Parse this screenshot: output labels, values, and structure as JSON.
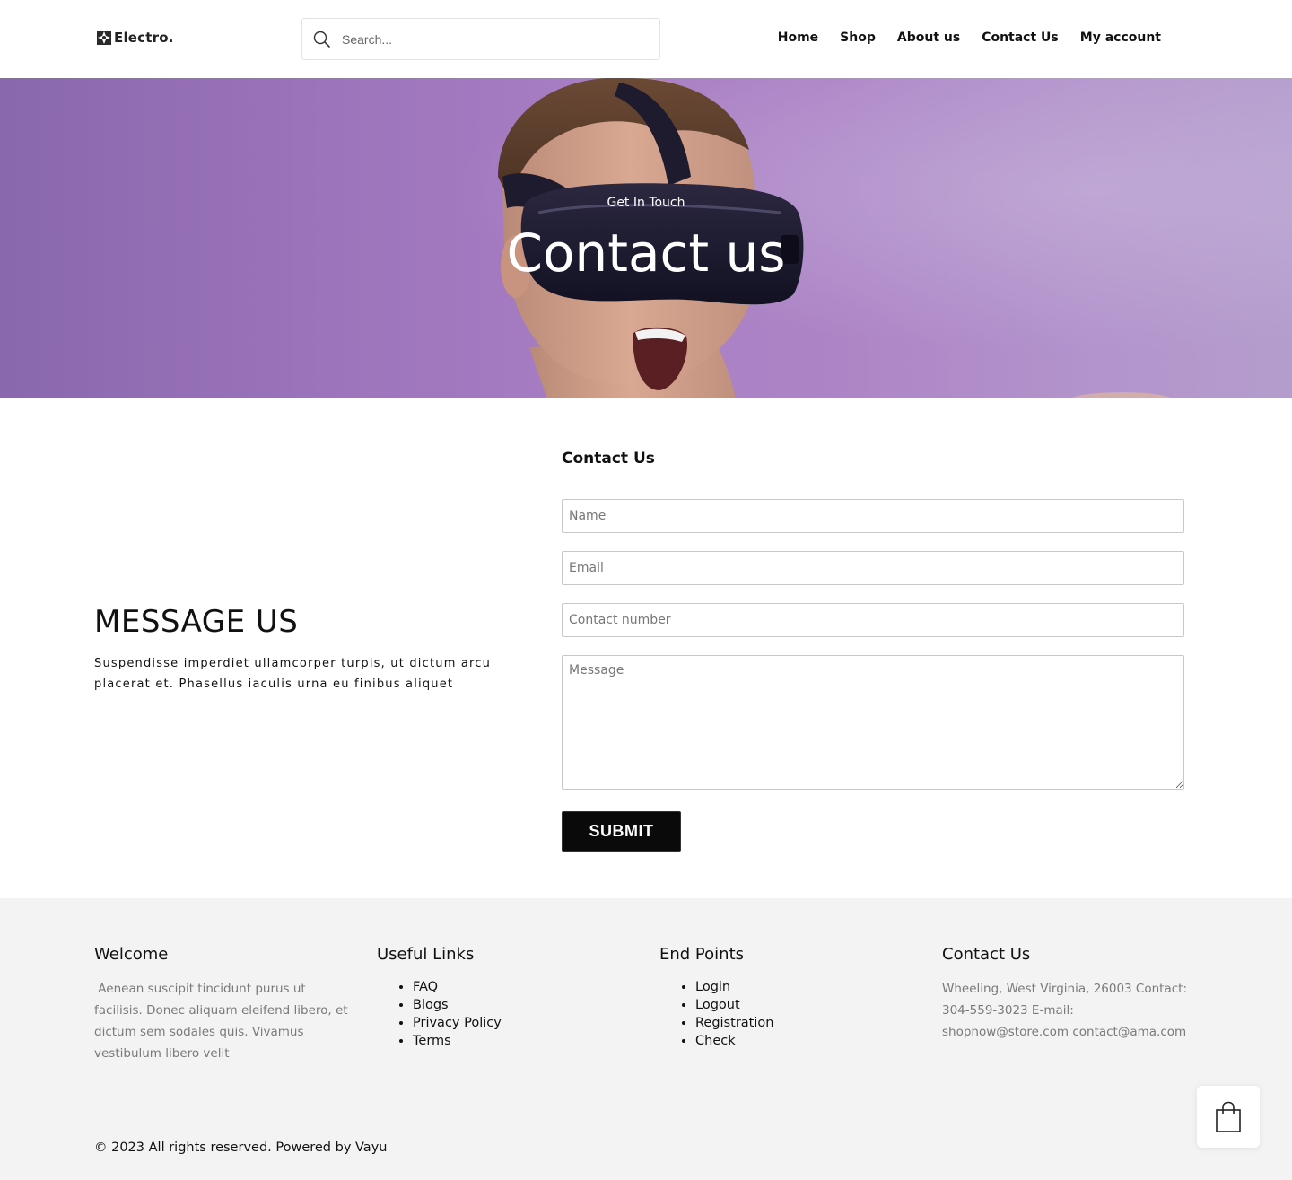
{
  "header": {
    "logo_text": "Electro.",
    "search": {
      "placeholder": "Search..."
    },
    "nav": [
      "Home",
      "Shop",
      "About us",
      "Contact Us",
      "My account"
    ]
  },
  "hero": {
    "subtitle": "Get In Touch",
    "title": "Contact us"
  },
  "message_section": {
    "title": "MESSAGE US",
    "text": "Suspendisse imperdiet ullamcorper turpis, ut dictum arcu placerat et. Phasellus iaculis urna eu finibus aliquet"
  },
  "contact_form": {
    "title": "Contact Us",
    "name_placeholder": "Name",
    "email_placeholder": "Email",
    "phone_placeholder": "Contact number",
    "message_placeholder": "Message",
    "submit_label": "SUBMIT"
  },
  "footer": {
    "welcome": {
      "title": "Welcome",
      "text": " Aenean suscipit tincidunt purus ut facilisis. Donec aliquam eleifend libero, et dictum sem sodales quis. Vivamus vestibulum libero velit"
    },
    "useful_links": {
      "title": "Useful Links",
      "items": [
        "FAQ",
        "Blogs",
        "Privacy Policy",
        "Terms"
      ]
    },
    "end_points": {
      "title": "End Points",
      "items": [
        "Login",
        "Logout",
        "Registration",
        "Check"
      ]
    },
    "contact": {
      "title": "Contact Us",
      "text": "Wheeling, West Virginia, 26003 Contact: 304-559-3023 E-mail: shopnow@store.com contact@ama.com"
    },
    "copyright": "© 2023 All rights reserved. Powered by Vayu"
  },
  "colors": {
    "hero_start": "#8a68ad",
    "hero_end": "#b49dcd",
    "footer_bg": "#f3f3f3",
    "button_bg": "#0a0a0a"
  },
  "icons": {
    "search": "search-icon",
    "cart": "shopping-bag-icon",
    "logo": "logo-icon"
  }
}
